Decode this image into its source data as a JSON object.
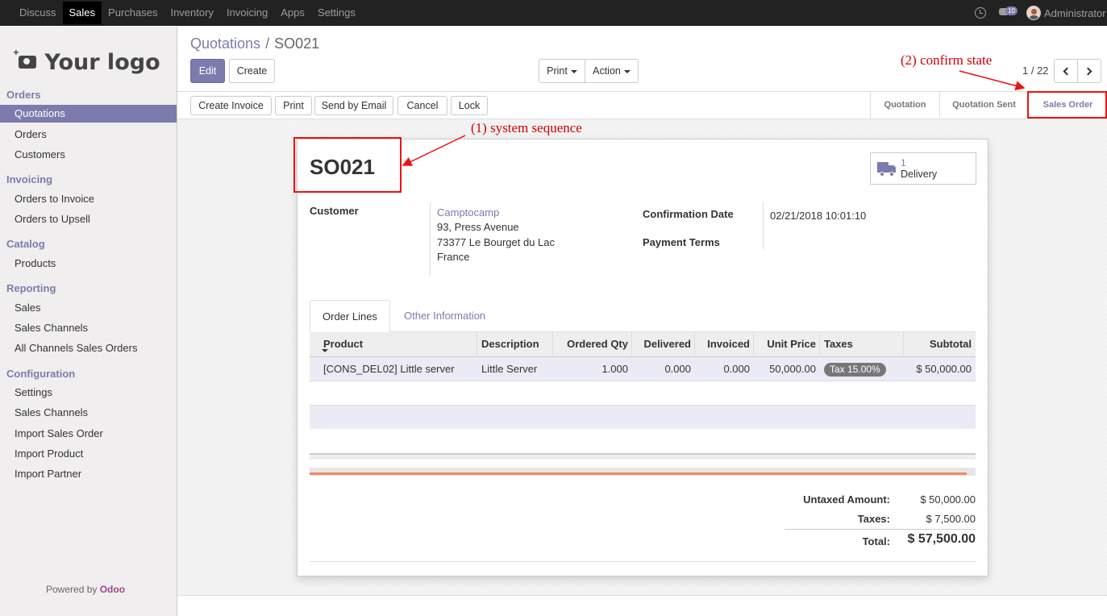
{
  "topbar": {
    "menu": [
      "Discuss",
      "Sales",
      "Purchases",
      "Inventory",
      "Invoicing",
      "Apps",
      "Settings"
    ],
    "active_menu": "Sales",
    "messages_count": "10",
    "user": "Administrator"
  },
  "sidebar": {
    "logo_text": "Your logo",
    "sections": [
      {
        "title": "Orders",
        "items": [
          "Quotations",
          "Orders",
          "Customers"
        ]
      },
      {
        "title": "Invoicing",
        "items": [
          "Orders to Invoice",
          "Orders to Upsell"
        ]
      },
      {
        "title": "Catalog",
        "items": [
          "Products"
        ]
      },
      {
        "title": "Reporting",
        "items": [
          "Sales",
          "Sales Channels",
          "All Channels Sales Orders"
        ]
      },
      {
        "title": "Configuration",
        "items": [
          "Settings",
          "Sales Channels",
          "Import Sales Order",
          "Import Product",
          "Import Partner"
        ]
      }
    ],
    "active_item": "Quotations",
    "powered_by": "Powered by",
    "powered_brand": "Odoo"
  },
  "breadcrumb": {
    "parent": "Quotations",
    "separator": "/",
    "current": "SO021"
  },
  "controls": {
    "edit": "Edit",
    "create": "Create",
    "print": "Print",
    "action": "Action",
    "pager": "1 / 22"
  },
  "header_buttons": [
    "Create Invoice",
    "Print",
    "Send by Email",
    "Cancel",
    "Lock"
  ],
  "statusbar": {
    "stages": [
      "Quotation",
      "Quotation Sent",
      "Sales Order"
    ],
    "active_stage": "Sales Order"
  },
  "record": {
    "name": "SO021",
    "smart_button": {
      "count": "1",
      "label": "Delivery"
    },
    "customer_label": "Customer",
    "customer_name": "Camptocamp",
    "customer_address": [
      "93, Press Avenue",
      "73377 Le Bourget du Lac",
      "France"
    ],
    "confirmation_date_label": "Confirmation Date",
    "confirmation_date": "02/21/2018 10:01:10",
    "payment_terms_label": "Payment Terms",
    "payment_terms": ""
  },
  "tabs": [
    "Order Lines",
    "Other Information"
  ],
  "order_lines": {
    "columns": [
      "Product",
      "Description",
      "Ordered Qty",
      "Delivered",
      "Invoiced",
      "Unit Price",
      "Taxes",
      "Subtotal"
    ],
    "rows": [
      {
        "product": "[CONS_DEL02] Little server",
        "description": "Little Server",
        "ordered_qty": "1.000",
        "delivered": "0.000",
        "invoiced": "0.000",
        "unit_price": "50,000.00",
        "taxes": "Tax 15.00%",
        "subtotal": "$ 50,000.00"
      }
    ]
  },
  "totals": {
    "untaxed_label": "Untaxed Amount:",
    "untaxed": "$ 50,000.00",
    "taxes_label": "Taxes:",
    "taxes": "$ 7,500.00",
    "total_label": "Total:",
    "total": "$ 57,500.00"
  },
  "annotations": {
    "system_sequence": "(1) system sequence",
    "confirm_state": "(2) confirm state"
  },
  "colors": {
    "accent": "#7c7bad",
    "annotation": "#e11111",
    "topbar": "#222222",
    "sidebar": "#f0eeee"
  }
}
